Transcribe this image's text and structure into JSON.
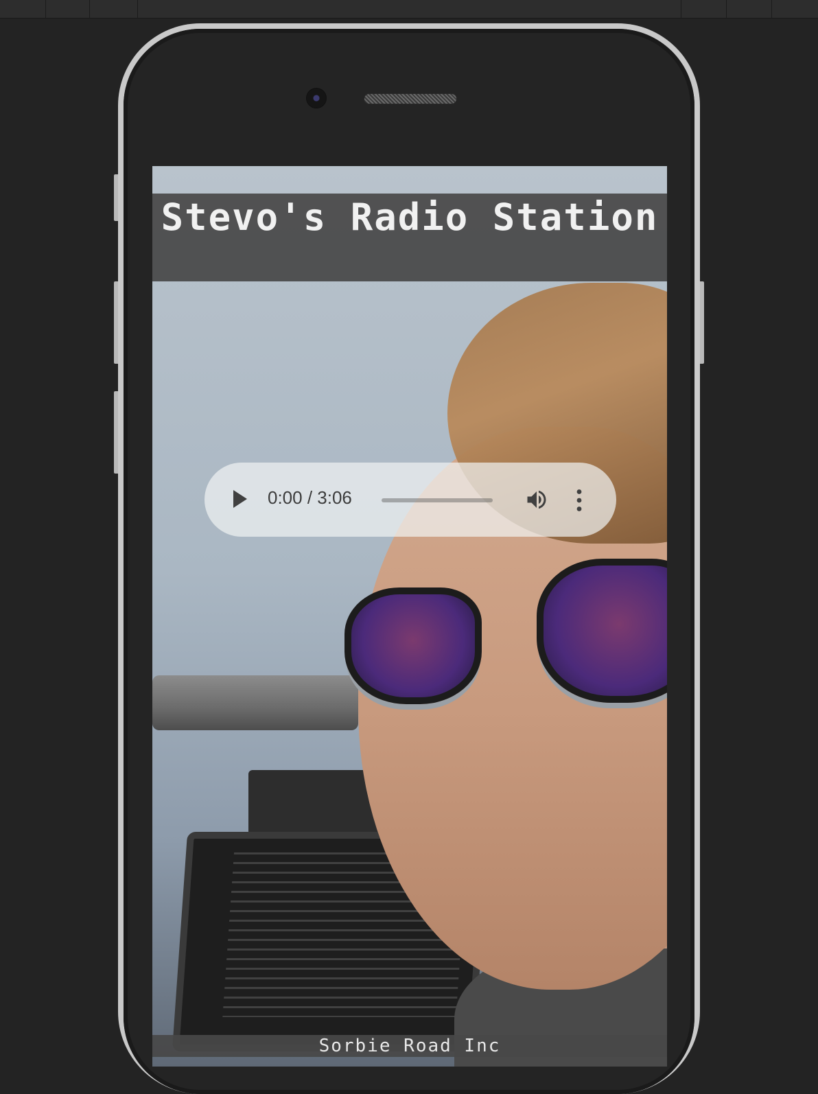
{
  "page": {
    "title": "Stevo's Radio Station",
    "footer": "Sorbie Road Inc"
  },
  "audio_player": {
    "current_time": "0:00",
    "separator": " / ",
    "duration": "3:06",
    "progress": 0,
    "icons": {
      "play": "play-icon",
      "volume": "volume-icon",
      "more": "more-options-icon"
    }
  },
  "colors": {
    "page_background": "#232323",
    "header_band": "#484848",
    "title_text": "#f1f1f1",
    "player_background": "#f1f3f4",
    "player_icons": "#404040"
  }
}
